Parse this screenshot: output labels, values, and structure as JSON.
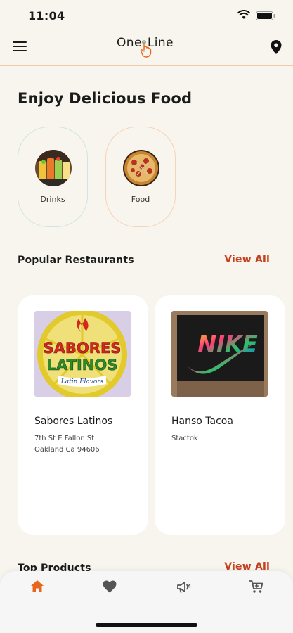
{
  "status_bar": {
    "time": "11:04"
  },
  "header": {
    "logo_part1": "One",
    "logo_part2": "Line"
  },
  "page_title": "Enjoy Delicious Food",
  "categories": [
    {
      "label": "Drinks",
      "icon": "drinks-image"
    },
    {
      "label": "Food",
      "icon": "pizza-image"
    }
  ],
  "popular": {
    "title": "Popular Restaurants",
    "view_all": "View All",
    "restaurants": [
      {
        "name": "Sabores Latinos",
        "address_line1": "7th St E Fallon St",
        "address_line2": "Oakland Ca 94606",
        "logo_text_line1": "SABORES",
        "logo_text_line2": "LATINOS",
        "logo_tagline": "Latin Flavors"
      },
      {
        "name": "Hanso Tacoa",
        "address_line1": "Stactok",
        "logo_text": "NIKE"
      }
    ]
  },
  "top_products": {
    "title": "Top Products",
    "view_all": "View All"
  },
  "bottom_nav": {
    "items": [
      {
        "icon": "home-icon",
        "active": true
      },
      {
        "icon": "heart-icon",
        "active": false
      },
      {
        "icon": "megaphone-icon",
        "active": false
      },
      {
        "icon": "cart-icon",
        "active": false
      }
    ]
  },
  "colors": {
    "accent": "#c4411f",
    "active_nav": "#e8661c",
    "background": "#f8f5ee",
    "header_border": "#f1c9a8"
  }
}
